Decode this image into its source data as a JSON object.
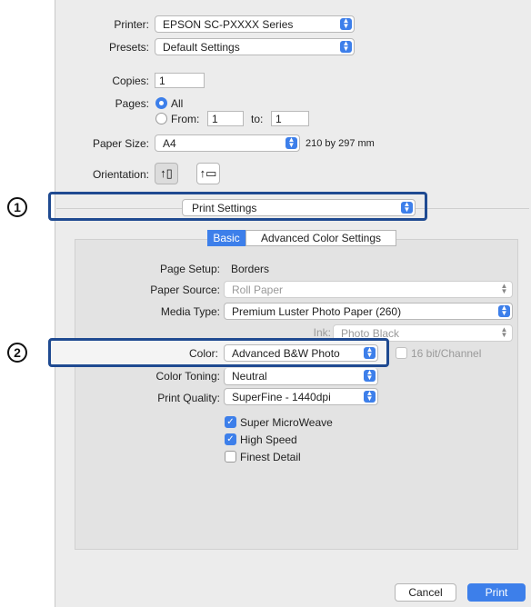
{
  "printer": {
    "label": "Printer:",
    "value": "EPSON SC-PXXXX Series"
  },
  "presets": {
    "label": "Presets:",
    "value": "Default Settings"
  },
  "copies": {
    "label": "Copies:",
    "value": "1"
  },
  "pages": {
    "label": "Pages:",
    "all_label": "All",
    "from_label": "From:",
    "from_value": "1",
    "to_label": "to:",
    "to_value": "1"
  },
  "paper_size": {
    "label": "Paper Size:",
    "value": "A4",
    "dimensions": "210 by 297 mm"
  },
  "orientation": {
    "label": "Orientation:"
  },
  "section_popup": {
    "value": "Print Settings"
  },
  "tabs": {
    "basic": "Basic",
    "advanced": "Advanced Color Settings"
  },
  "settings": {
    "page_setup": {
      "label": "Page Setup:",
      "value": "Borders"
    },
    "paper_source": {
      "label": "Paper Source:",
      "value": "Roll Paper"
    },
    "media_type": {
      "label": "Media Type:",
      "value": "Premium Luster Photo Paper (260)"
    },
    "ink": {
      "label": "Ink:",
      "value": "Photo Black"
    },
    "color": {
      "label": "Color:",
      "value": "Advanced B&W Photo"
    },
    "bit_channel": {
      "label": "16 bit/Channel"
    },
    "color_toning": {
      "label": "Color Toning:",
      "value": "Neutral"
    },
    "print_quality": {
      "label": "Print Quality:",
      "value": "SuperFine - 1440dpi"
    }
  },
  "checkboxes": {
    "super_microweave": "Super MicroWeave",
    "high_speed": "High Speed",
    "finest_detail": "Finest Detail"
  },
  "callouts": {
    "one": "1",
    "two": "2"
  },
  "buttons": {
    "cancel": "Cancel",
    "print": "Print"
  },
  "colors": {
    "accent": "#3d7fea",
    "callout_border": "#1f4a91"
  }
}
